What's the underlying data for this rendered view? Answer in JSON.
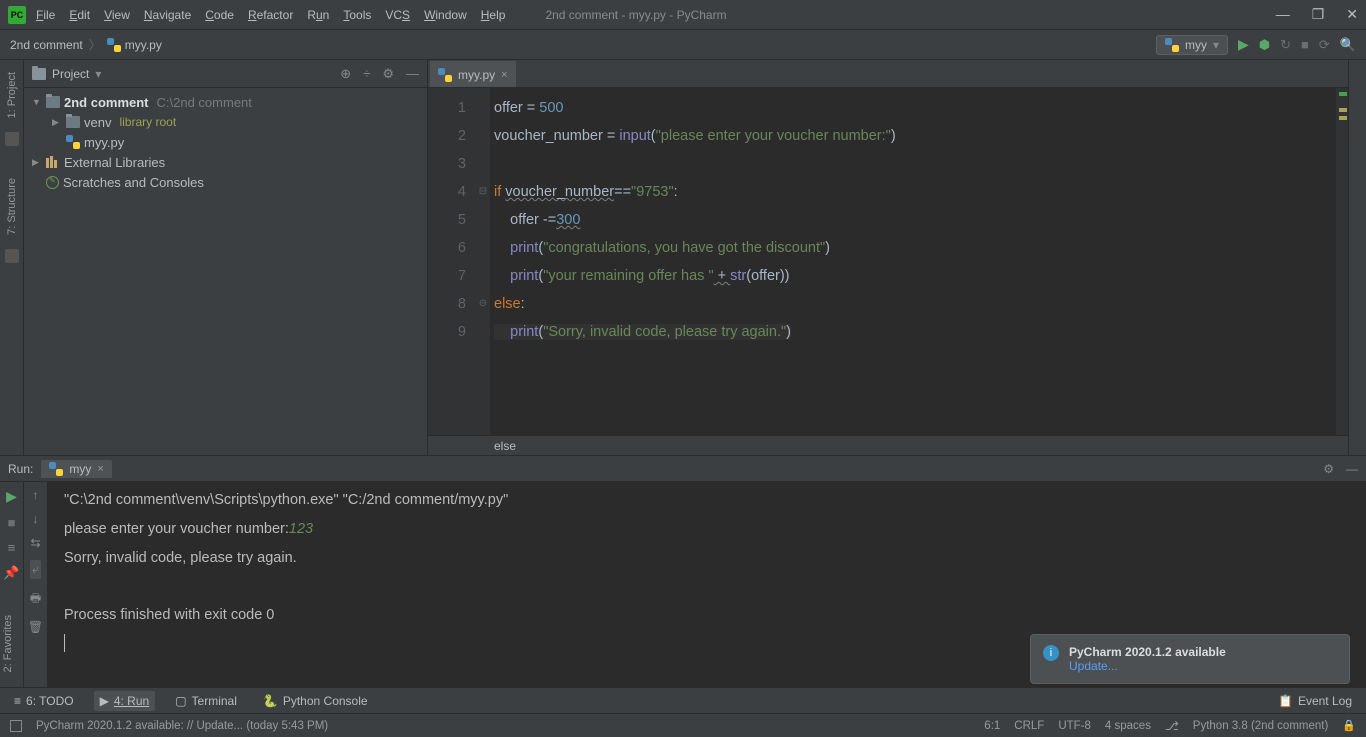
{
  "window": {
    "title": "2nd comment - myy.py - PyCharm",
    "app": "PC"
  },
  "menubar": [
    "File",
    "Edit",
    "View",
    "Navigate",
    "Code",
    "Refactor",
    "Run",
    "Tools",
    "VCS",
    "Window",
    "Help"
  ],
  "breadcrumb": {
    "root": "2nd comment",
    "file": "myy.py"
  },
  "runConfig": {
    "name": "myy"
  },
  "projectPanel": {
    "title": "Project",
    "tree": {
      "root": "2nd comment",
      "rootPath": "C:\\2nd comment",
      "venv": "venv",
      "venvHint": "library root",
      "file": "myy.py",
      "extLib": "External Libraries",
      "scratches": "Scratches and Consoles"
    }
  },
  "leftTabs": {
    "project": "1: Project",
    "structure": "7: Structure"
  },
  "rightTabs": {
    "favorites": "2: Favorites"
  },
  "editor": {
    "tab": "myy.py",
    "lines": {
      "1": {
        "kw1": "offer ",
        "op": "= ",
        "num": "500"
      },
      "2": {
        "a": "voucher_number ",
        "op": "= ",
        "fn": "input",
        "p": "(",
        "s": "\"please enter your voucher number:\"",
        "pe": ")"
      },
      "4a": "if ",
      "4b": "voucher_number",
      "4c": "==",
      "4d": "\"9753\"",
      "4e": ":",
      "5a": "offer ",
      "5b": "-=",
      "5c": "300",
      "6a": "print",
      "6b": "(",
      "6c": "\"congratulations, you have got the discount\"",
      "6d": ")",
      "7a": "print",
      "7b": "(",
      "7c": "\"your remaining offer has \"",
      "7d": " + ",
      "7e": "str",
      "7f": "(offer))",
      "8a": "else",
      "8b": ":",
      "9a": "print",
      "9b": "(",
      "9c": "\"Sorry, invalid code, please try again.\"",
      "9d": ")"
    },
    "crumb": "else"
  },
  "run": {
    "label": "Run:",
    "tab": "myy",
    "out1": "\"C:\\2nd comment\\venv\\Scripts\\python.exe\" \"C:/2nd comment/myy.py\"",
    "out2a": "please enter your voucher number:",
    "out2b": "123",
    "out3": "Sorry, invalid code, please try again.",
    "out4": "Process finished with exit code 0"
  },
  "bottomTabs": {
    "todo": "6: TODO",
    "run": "4: Run",
    "terminal": "Terminal",
    "pyconsole": "Python Console",
    "eventlog": "Event Log"
  },
  "notification": {
    "title": "PyCharm 2020.1.2 available",
    "link": "Update..."
  },
  "status": {
    "left": "PyCharm 2020.1.2 available: // Update... (today 5:43 PM)",
    "pos": "6:1",
    "sep": "CRLF",
    "enc": "UTF-8",
    "indent": "4 spaces",
    "py": "Python 3.8 (2nd comment)"
  }
}
